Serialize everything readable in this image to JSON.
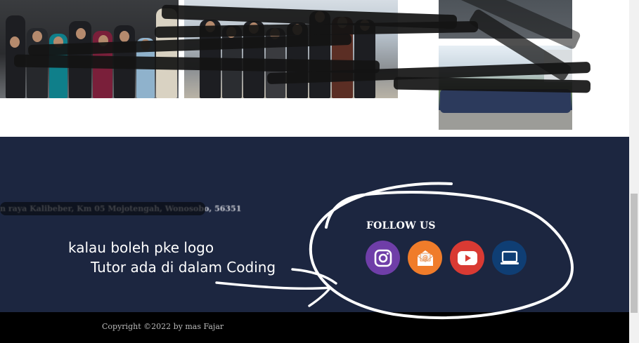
{
  "gallery": {
    "photos": [
      {
        "name": "Group photo 1"
      },
      {
        "name": "Group photo 2"
      },
      {
        "name": "Group photo 3"
      },
      {
        "name": "Group photo 4"
      }
    ]
  },
  "footer": {
    "address": "n raya Kalibeber, Km 05 Mojotengah, Wonosobo, 56351",
    "annotation_line1": "kalau boleh pke logo",
    "annotation_line2": "Tutor ada di dalam Coding",
    "follow_title": "FOLLOW US",
    "social_links": [
      {
        "icon": "instagram-icon",
        "color": "#6f3ea8"
      },
      {
        "icon": "email-icon",
        "color": "#f07c2a"
      },
      {
        "icon": "youtube-icon",
        "color": "#d93a33"
      },
      {
        "icon": "laptop-icon",
        "color": "#0f3e74"
      }
    ]
  },
  "copyright": {
    "text": "Copyright ©2022 by mas Fajar"
  },
  "colors": {
    "footer_bg": "#1c2640",
    "copyright_bg": "#000000",
    "annotation": "#ffffff"
  }
}
